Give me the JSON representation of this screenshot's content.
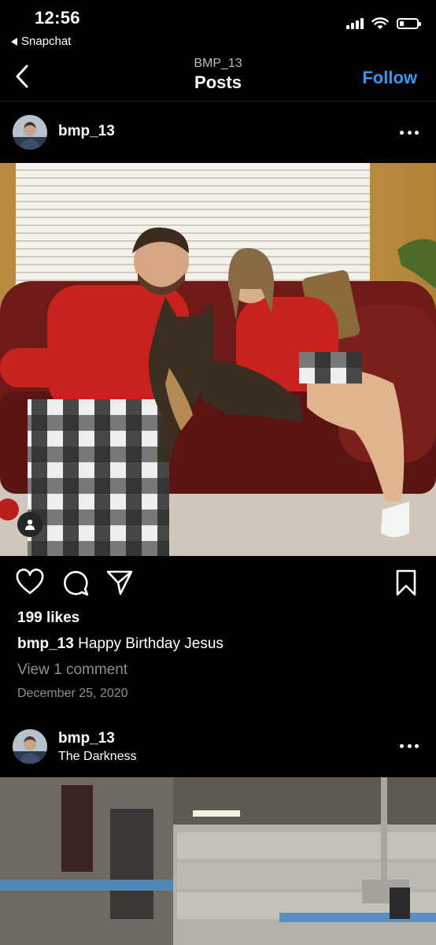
{
  "status_bar": {
    "time": "12:56",
    "back_app": "Snapchat",
    "battery_level": 0.25
  },
  "header": {
    "subtitle": "BMP_13",
    "title": "Posts",
    "follow_label": "Follow"
  },
  "posts": [
    {
      "username": "bmp_13",
      "location": "",
      "likes": "199 likes",
      "caption_user": "bmp_13",
      "caption_text": "Happy Birthday Jesus",
      "view_comments": "View 1 comment",
      "date": "December 25, 2020"
    },
    {
      "username": "bmp_13",
      "location": "The Darkness"
    }
  ],
  "icons": [
    "back-chevron-icon",
    "heart-icon",
    "comment-icon",
    "share-icon",
    "bookmark-icon",
    "more-icon",
    "tag-person-icon"
  ],
  "colors": {
    "accent": "#3897f0",
    "muted": "#8e8e8e",
    "background": "#000000"
  }
}
